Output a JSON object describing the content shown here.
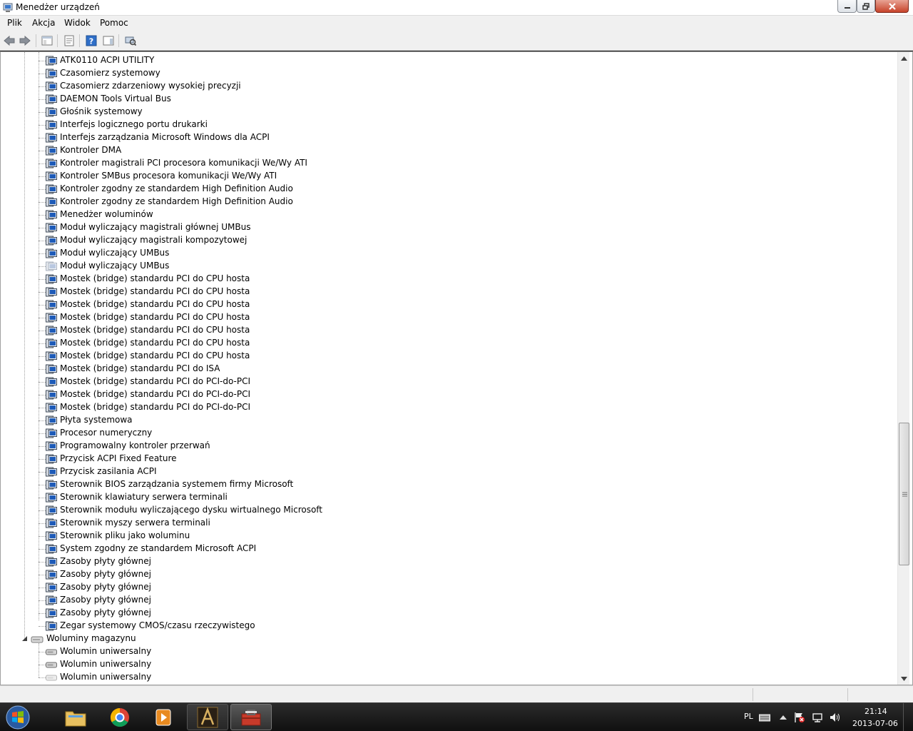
{
  "window": {
    "title": "Menedżer urządzeń"
  },
  "menu": [
    "Plik",
    "Akcja",
    "Widok",
    "Pomoc"
  ],
  "tree": {
    "system_devices": [
      {
        "label": "ATK0110 ACPI UTILITY",
        "disabled": false
      },
      {
        "label": "Czasomierz systemowy",
        "disabled": false
      },
      {
        "label": "Czasomierz zdarzeniowy wysokiej precyzji",
        "disabled": false
      },
      {
        "label": "DAEMON Tools Virtual Bus",
        "disabled": false
      },
      {
        "label": "Głośnik systemowy",
        "disabled": false
      },
      {
        "label": "Interfejs logicznego portu drukarki",
        "disabled": false
      },
      {
        "label": "Interfejs zarządzania Microsoft Windows dla ACPI",
        "disabled": false
      },
      {
        "label": "Kontroler DMA",
        "disabled": false
      },
      {
        "label": "Kontroler magistrali PCI procesora komunikacji We/Wy ATI",
        "disabled": false
      },
      {
        "label": "Kontroler SMBus procesora komunikacji We/Wy ATI",
        "disabled": false
      },
      {
        "label": "Kontroler zgodny ze standardem High Definition Audio",
        "disabled": false
      },
      {
        "label": "Kontroler zgodny ze standardem High Definition Audio",
        "disabled": false
      },
      {
        "label": "Menedżer woluminów",
        "disabled": false
      },
      {
        "label": "Moduł wyliczający magistrali głównej UMBus",
        "disabled": false
      },
      {
        "label": "Moduł wyliczający magistrali kompozytowej",
        "disabled": false
      },
      {
        "label": "Moduł wyliczający UMBus",
        "disabled": false
      },
      {
        "label": "Moduł wyliczający UMBus",
        "disabled": true
      },
      {
        "label": "Mostek (bridge) standardu PCI do CPU hosta",
        "disabled": false
      },
      {
        "label": "Mostek (bridge) standardu PCI do CPU hosta",
        "disabled": false
      },
      {
        "label": "Mostek (bridge) standardu PCI do CPU hosta",
        "disabled": false
      },
      {
        "label": "Mostek (bridge) standardu PCI do CPU hosta",
        "disabled": false
      },
      {
        "label": "Mostek (bridge) standardu PCI do CPU hosta",
        "disabled": false
      },
      {
        "label": "Mostek (bridge) standardu PCI do CPU hosta",
        "disabled": false
      },
      {
        "label": "Mostek (bridge) standardu PCI do CPU hosta",
        "disabled": false
      },
      {
        "label": "Mostek (bridge) standardu PCI do ISA",
        "disabled": false
      },
      {
        "label": "Mostek (bridge) standardu PCI do PCI-do-PCI",
        "disabled": false
      },
      {
        "label": "Mostek (bridge) standardu PCI do PCI-do-PCI",
        "disabled": false
      },
      {
        "label": "Mostek (bridge) standardu PCI do PCI-do-PCI",
        "disabled": false
      },
      {
        "label": "Płyta systemowa",
        "disabled": false
      },
      {
        "label": "Procesor numeryczny",
        "disabled": false
      },
      {
        "label": "Programowalny kontroler przerwań",
        "disabled": false
      },
      {
        "label": "Przycisk ACPI Fixed Feature",
        "disabled": false
      },
      {
        "label": "Przycisk zasilania ACPI",
        "disabled": false
      },
      {
        "label": "Sterownik BIOS zarządzania systemem firmy Microsoft",
        "disabled": false
      },
      {
        "label": "Sterownik klawiatury serwera terminali",
        "disabled": false
      },
      {
        "label": "Sterownik modułu wyliczającego dysku wirtualnego Microsoft",
        "disabled": false
      },
      {
        "label": "Sterownik myszy serwera terminali",
        "disabled": false
      },
      {
        "label": "Sterownik pliku jako woluminu",
        "disabled": false
      },
      {
        "label": "System zgodny ze standardem Microsoft ACPI",
        "disabled": false
      },
      {
        "label": "Zasoby płyty głównej",
        "disabled": false
      },
      {
        "label": "Zasoby płyty głównej",
        "disabled": false
      },
      {
        "label": "Zasoby płyty głównej",
        "disabled": false
      },
      {
        "label": "Zasoby płyty głównej",
        "disabled": false
      },
      {
        "label": "Zasoby płyty głównej",
        "disabled": false
      },
      {
        "label": "Zegar systemowy CMOS/czasu rzeczywistego",
        "disabled": false
      }
    ],
    "storage_category": {
      "label": "Woluminy magazynu",
      "expanded": true,
      "children": [
        {
          "label": "Wolumin uniwersalny",
          "disabled": false
        },
        {
          "label": "Wolumin uniwersalny",
          "disabled": false
        },
        {
          "label": "Wolumin uniwersalny",
          "disabled": true
        }
      ]
    }
  },
  "scrollbar": {
    "position_fraction": 0.77
  },
  "tray": {
    "language": "PL",
    "time": "21:14",
    "date": "2013-07-06"
  },
  "colors": {
    "taskbar": "#1c1c1c",
    "close_button": "#c7432a",
    "device_icon_blue": "#1e5bb8"
  }
}
